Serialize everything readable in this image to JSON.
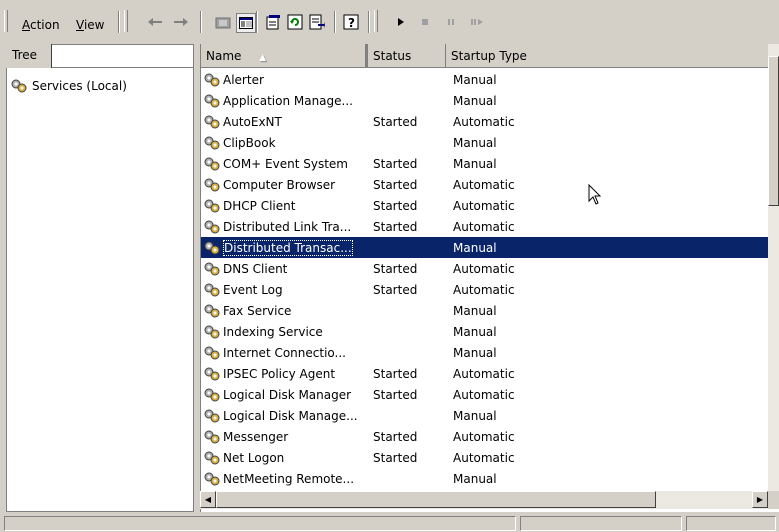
{
  "menu": {
    "action": "Action",
    "view": "View"
  },
  "tree": {
    "tab_label": "Tree",
    "root_label": "Services (Local)"
  },
  "list": {
    "columns": {
      "name": "Name",
      "status": "Status",
      "startup": "Startup Type"
    },
    "rows": [
      {
        "name": "Alerter",
        "status": "",
        "startup": "Manual"
      },
      {
        "name": "Application Manage...",
        "status": "",
        "startup": "Manual"
      },
      {
        "name": "AutoExNT",
        "status": "Started",
        "startup": "Automatic"
      },
      {
        "name": "ClipBook",
        "status": "",
        "startup": "Manual"
      },
      {
        "name": "COM+ Event System",
        "status": "Started",
        "startup": "Manual"
      },
      {
        "name": "Computer Browser",
        "status": "Started",
        "startup": "Automatic"
      },
      {
        "name": "DHCP Client",
        "status": "Started",
        "startup": "Automatic"
      },
      {
        "name": "Distributed Link Tra...",
        "status": "Started",
        "startup": "Automatic"
      },
      {
        "name": "Distributed Transac...",
        "status": "",
        "startup": "Manual",
        "selected": true
      },
      {
        "name": "DNS Client",
        "status": "Started",
        "startup": "Automatic"
      },
      {
        "name": "Event Log",
        "status": "Started",
        "startup": "Automatic"
      },
      {
        "name": "Fax Service",
        "status": "",
        "startup": "Manual"
      },
      {
        "name": "Indexing Service",
        "status": "",
        "startup": "Manual"
      },
      {
        "name": "Internet Connectio...",
        "status": "",
        "startup": "Manual"
      },
      {
        "name": "IPSEC Policy Agent",
        "status": "Started",
        "startup": "Automatic"
      },
      {
        "name": "Logical Disk Manager",
        "status": "Started",
        "startup": "Automatic"
      },
      {
        "name": "Logical Disk Manage...",
        "status": "",
        "startup": "Manual"
      },
      {
        "name": "Messenger",
        "status": "Started",
        "startup": "Automatic"
      },
      {
        "name": "Net Logon",
        "status": "Started",
        "startup": "Automatic"
      },
      {
        "name": "NetMeeting Remote...",
        "status": "",
        "startup": "Manual"
      }
    ]
  },
  "colors": {
    "selection": "#0a246a",
    "chrome": "#d4d0c8"
  },
  "icons": [
    "back-arrow-icon",
    "forward-arrow-icon",
    "up-folder-icon",
    "show-tree-icon",
    "properties-icon",
    "refresh-icon",
    "export-list-icon",
    "help-icon",
    "play-icon",
    "stop-icon",
    "pause-icon",
    "restart-icon",
    "gear-service-icon"
  ]
}
